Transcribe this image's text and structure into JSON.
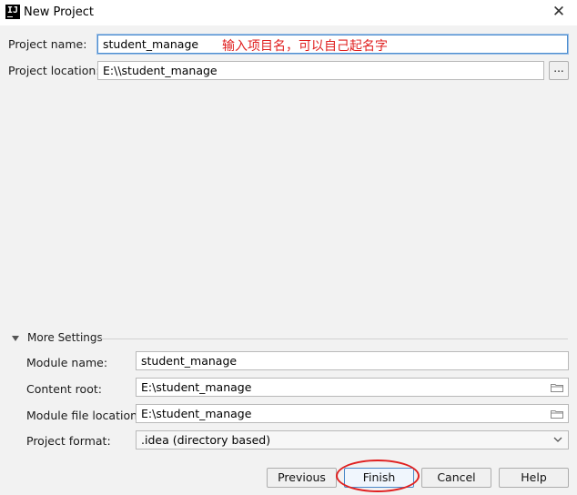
{
  "window": {
    "title": "New Project",
    "close_glyph": "✕"
  },
  "form": {
    "project_name_label": "Project name:",
    "project_name_value": "student_manage",
    "project_location_label": "Project location:",
    "project_location_value": "E:\\\\student_manage",
    "browse_label": "..."
  },
  "annotation": {
    "text": "输入项目名，可以自己起名字",
    "color": "#e02020"
  },
  "more_settings": {
    "title": "More Settings",
    "expanded": true,
    "module_name_label": "Module name:",
    "module_name_value": "student_manage",
    "content_root_label": "Content root:",
    "content_root_value": "E:\\student_manage",
    "module_file_location_label": "Module file location:",
    "module_file_location_value": "E:\\student_manage",
    "project_format_label": "Project format:",
    "project_format_value": ".idea (directory based)"
  },
  "buttons": {
    "previous": "Previous",
    "finish": "Finish",
    "cancel": "Cancel",
    "help": "Help"
  },
  "highlight": {
    "target": "finish-button",
    "color": "#e02020"
  }
}
